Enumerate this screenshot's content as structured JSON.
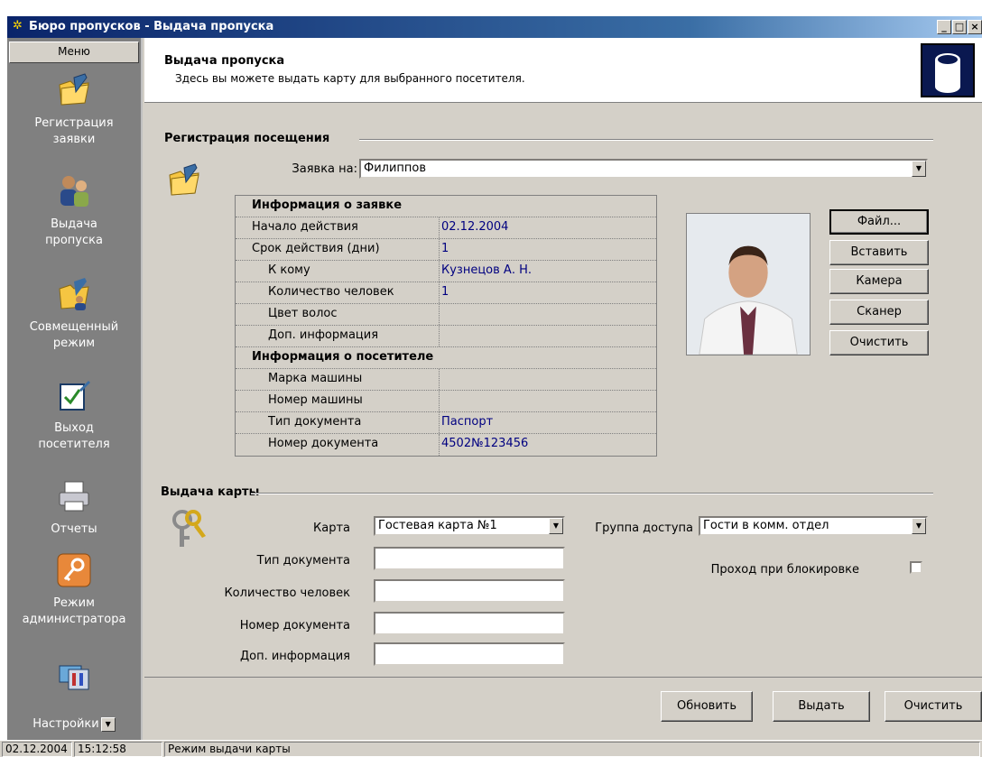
{
  "window": {
    "title": "Бюро пропусков - Выдача пропуска",
    "controls": [
      "_",
      "□",
      "×"
    ]
  },
  "sidebar": {
    "menu_label": "Меню",
    "items": [
      {
        "label": "Регистрация\nзаявки",
        "icon": "folder-pen-icon"
      },
      {
        "label": "Выдача\nпропуска",
        "icon": "people-icon"
      },
      {
        "label": "Совмещенный\nрежим",
        "icon": "folder-people-icon"
      },
      {
        "label": "Выход\nпосетителя",
        "icon": "checkbox-pen-icon"
      },
      {
        "label": "Отчеты",
        "icon": "printer-icon"
      },
      {
        "label": "Режим\nадминистратора",
        "icon": "key-icon"
      },
      {
        "label": "Настройки",
        "icon": "settings-icon"
      }
    ]
  },
  "header": {
    "title": "Выдача пропуска",
    "subtitle": "Здесь вы можете выдать карту для выбранного посетителя."
  },
  "registration": {
    "section_title": "Регистрация посещения",
    "request_label": "Заявка на:",
    "request_value": "Филиппов",
    "grid": {
      "request_header": "Информация о заявке",
      "request_rows": [
        {
          "key": "Начало действия",
          "value": "02.12.2004",
          "indent": false
        },
        {
          "key": "Срок действия (дни)",
          "value": "1",
          "indent": false
        },
        {
          "key": "К кому",
          "value": "Кузнецов А. Н.",
          "indent": true
        },
        {
          "key": "Количество человек",
          "value": "1",
          "indent": true
        },
        {
          "key": "Цвет волос",
          "value": "",
          "indent": true
        },
        {
          "key": "Доп. информация",
          "value": "",
          "indent": true
        }
      ],
      "visitor_header": "Информация о посетителе",
      "visitor_rows": [
        {
          "key": "Марка машины",
          "value": ""
        },
        {
          "key": "Номер машины",
          "value": ""
        },
        {
          "key": "Тип документа",
          "value": "Паспорт"
        },
        {
          "key": "Номер документа",
          "value": "4502№123456"
        }
      ]
    },
    "photo_buttons": {
      "file": "Файл...",
      "paste": "Вставить",
      "camera": "Камера",
      "scanner": "Сканер",
      "clear": "Очистить"
    }
  },
  "card_issue": {
    "section_title": "Выдача карты",
    "card_label": "Карта",
    "card_value": "Гостевая карта №1",
    "doc_type_label": "Тип документа",
    "people_count_label": "Количество человек",
    "doc_number_label": "Номер документа",
    "extra_info_label": "Доп. информация",
    "access_group_label": "Группа доступа",
    "access_group_value": "Гости в комм. отдел",
    "block_pass_label": "Проход при блокировке",
    "block_pass_checked": false
  },
  "footer": {
    "refresh": "Обновить",
    "issue": "Выдать",
    "clear": "Очистить"
  },
  "statusbar": {
    "date": "02.12.2004",
    "time": "15:12:58",
    "mode": "Режим выдачи карты"
  }
}
